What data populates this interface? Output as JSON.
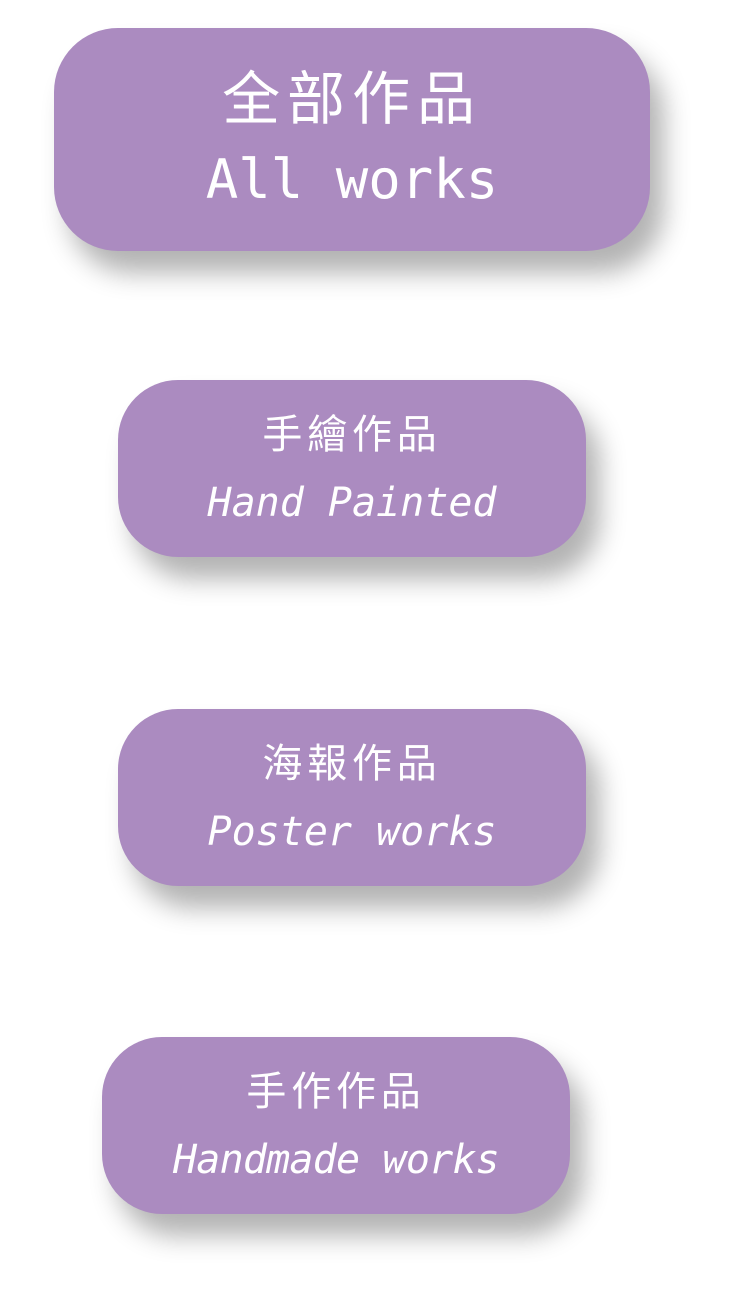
{
  "categories": [
    {
      "zh": "全部作品",
      "en": "All works"
    },
    {
      "zh": "手繪作品",
      "en": "Hand Painted"
    },
    {
      "zh": "海報作品",
      "en": "Poster works"
    },
    {
      "zh": "手作作品",
      "en": "Handmade works"
    }
  ],
  "colors": {
    "button_bg": "#ab8bc0",
    "button_text": "#ffffff",
    "page_bg": "#ffffff"
  }
}
